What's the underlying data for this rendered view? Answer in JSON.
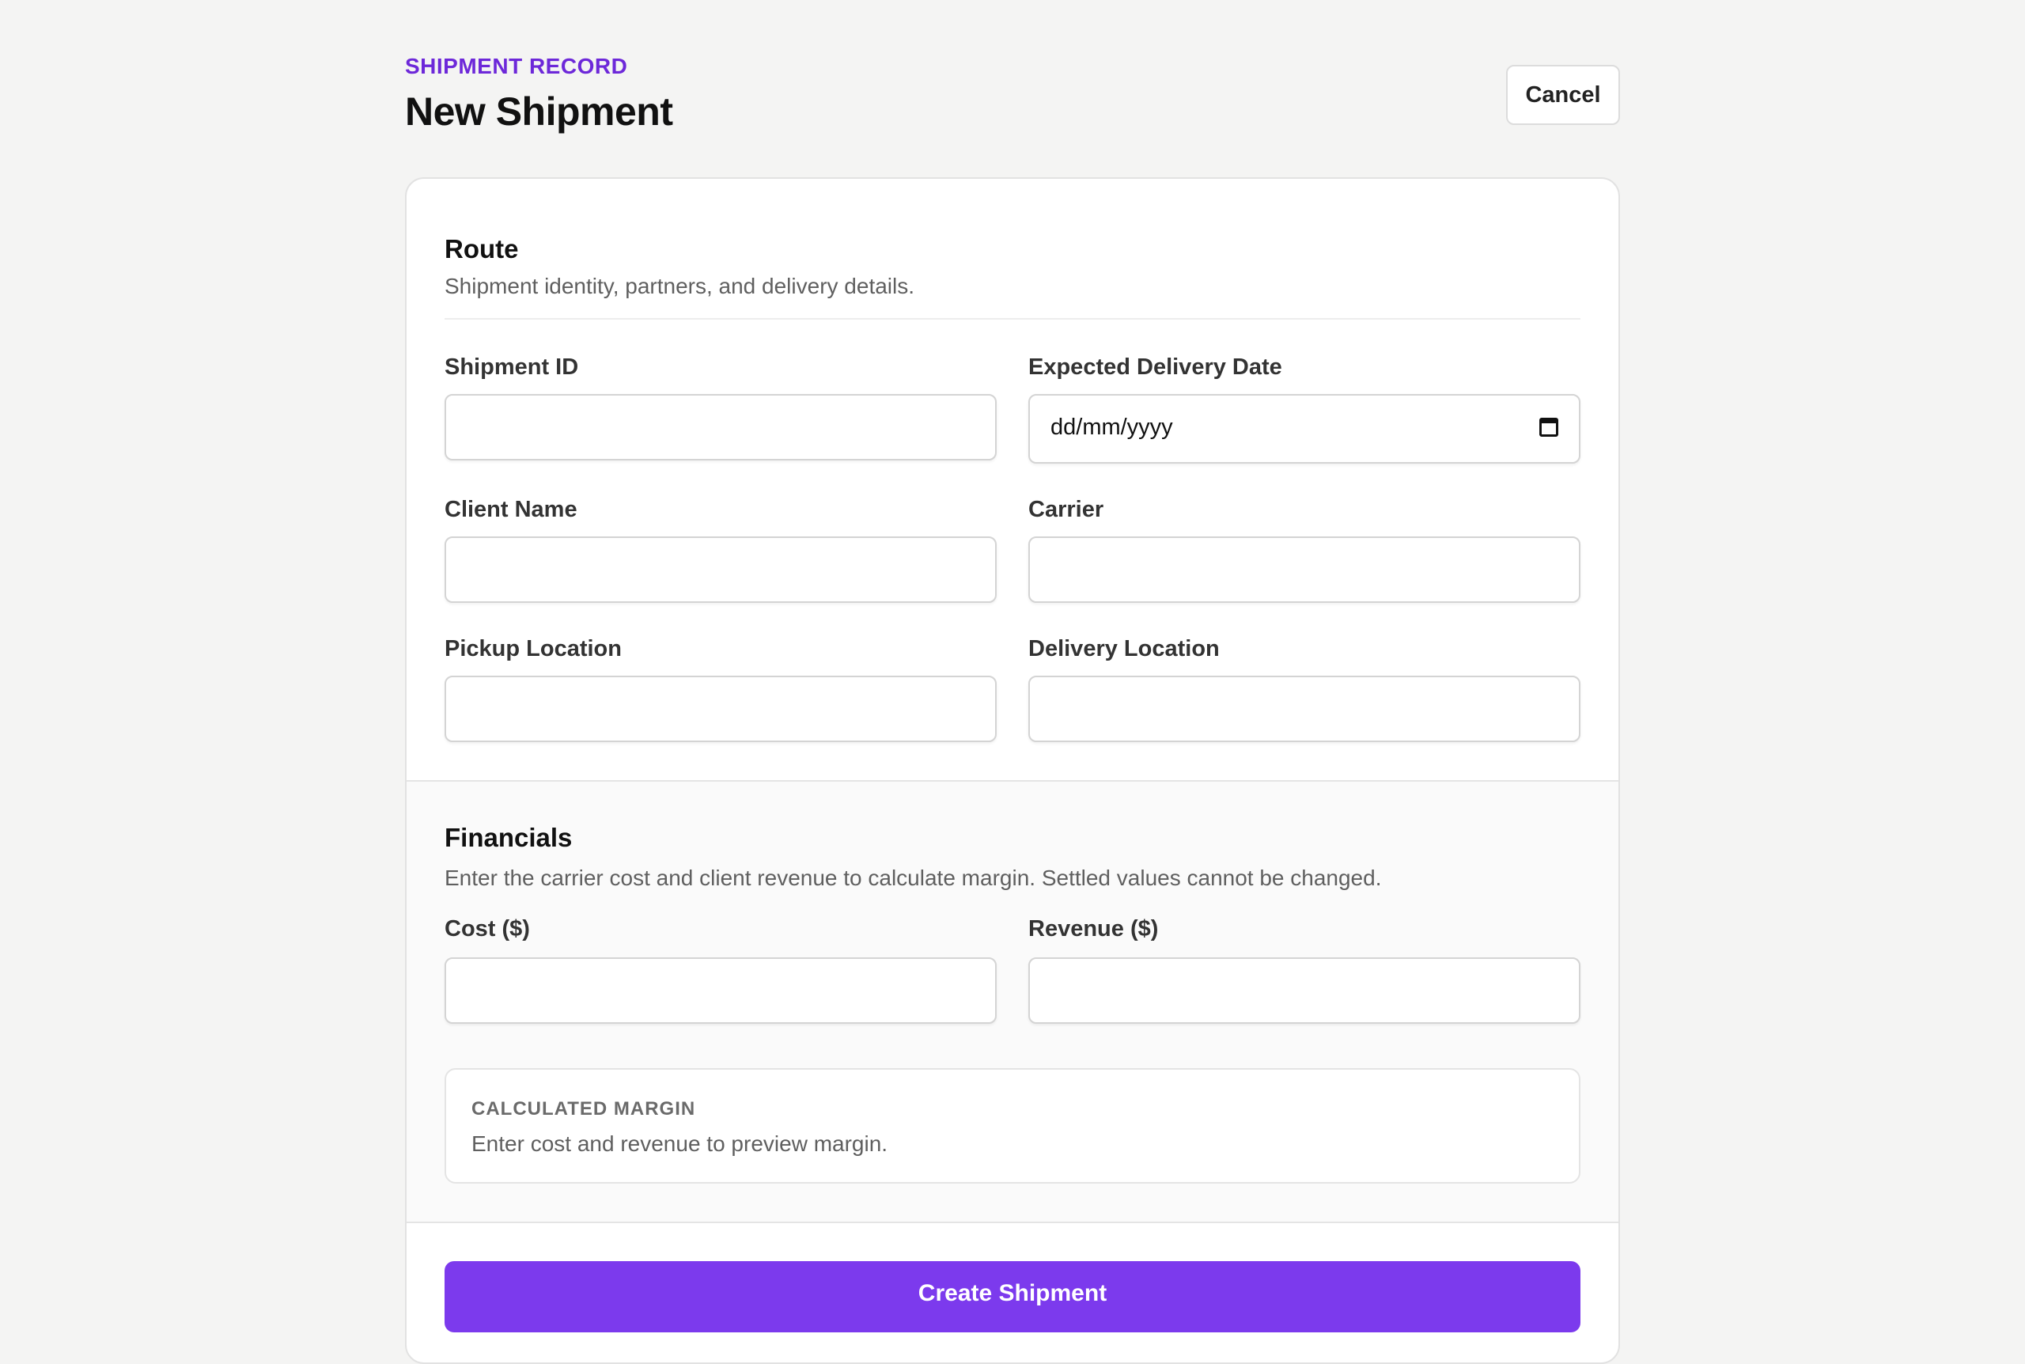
{
  "header": {
    "eyebrow": "SHIPMENT RECORD",
    "title": "New Shipment",
    "cancel_label": "Cancel"
  },
  "route": {
    "title": "Route",
    "description": "Shipment identity, partners, and delivery details.",
    "fields": {
      "shipment_id": {
        "label": "Shipment ID",
        "value": ""
      },
      "expected_delivery_date": {
        "label": "Expected Delivery Date",
        "value": "",
        "placeholder": "dd/mm/yyyy"
      },
      "client_name": {
        "label": "Client Name",
        "value": ""
      },
      "carrier": {
        "label": "Carrier",
        "value": ""
      },
      "pickup_location": {
        "label": "Pickup Location",
        "value": ""
      },
      "delivery_location": {
        "label": "Delivery Location",
        "value": ""
      }
    }
  },
  "financials": {
    "title": "Financials",
    "description": "Enter the carrier cost and client revenue to calculate margin. Settled values cannot be changed.",
    "fields": {
      "cost": {
        "label": "Cost ($)",
        "value": ""
      },
      "revenue": {
        "label": "Revenue ($)",
        "value": ""
      }
    },
    "margin": {
      "label": "CALCULATED MARGIN",
      "text": "Enter cost and revenue to preview margin."
    }
  },
  "submit_label": "Create Shipment",
  "colors": {
    "accent": "#7c3aed",
    "eyebrow": "#6d28d9",
    "background": "#f4f4f3"
  }
}
